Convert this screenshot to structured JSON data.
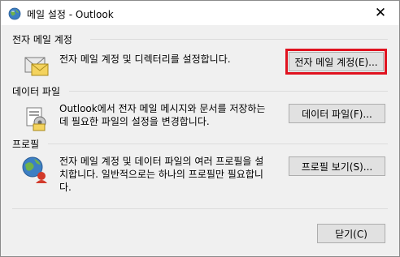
{
  "window": {
    "title": "메일 설정 - Outlook",
    "close_glyph": "✕"
  },
  "sections": {
    "email": {
      "label": "전자 메일 계정",
      "icon": "mail-accounts-icon",
      "description": "전자 메일 계정 및 디렉터리를 설정합니다.",
      "button_label": "전자 메일 계정(E)..."
    },
    "datafile": {
      "label": "데이터 파일",
      "icon": "data-file-icon",
      "description_line1": "Outlook에서 전자 메일 메시지와 문서를 저장하는",
      "description_line2": "데 필요한 파일의 설정을 변경합니다.",
      "button_label": "데이터 파일(F)..."
    },
    "profiles": {
      "label": "프로필",
      "icon": "profile-globe-icon",
      "description_line1": "전자 메일 계정 및 데이터 파일의 여러 프로필을 설",
      "description_line2": "치합니다. 일반적으로는 하나의 프로필만 필요합니",
      "description_line3": "다.",
      "button_label": "프로필 보기(S)..."
    }
  },
  "footer": {
    "close_button_label": "닫기(C)"
  },
  "colors": {
    "highlight": "#e0121f",
    "button_bg": "#e1e1e1",
    "dialog_bg": "#f0f0f0"
  }
}
